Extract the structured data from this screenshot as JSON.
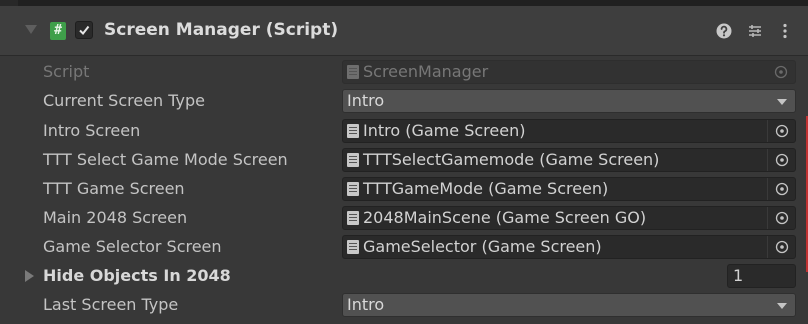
{
  "component": {
    "title": "Screen Manager (Script)",
    "enabled": true
  },
  "fields": {
    "script": {
      "label": "Script",
      "value": "ScreenManager"
    },
    "current_screen_type": {
      "label": "Current Screen Type",
      "value": "Intro"
    },
    "intro_screen": {
      "label": "Intro Screen",
      "value": "Intro (Game Screen)"
    },
    "ttt_select_game_mode_screen": {
      "label": "TTT Select Game Mode Screen",
      "value": "TTTSelectGamemode (Game Screen)"
    },
    "ttt_game_screen": {
      "label": "TTT Game Screen",
      "value": "TTTGameMode (Game Screen)"
    },
    "main_2048_screen": {
      "label": "Main 2048 Screen",
      "value": "2048MainScene (Game Screen GO)"
    },
    "game_selector_screen": {
      "label": "Game Selector Screen",
      "value": "GameSelector (Game Screen)"
    },
    "hide_objects_in_2048": {
      "label": "Hide Objects In 2048",
      "value": "1"
    },
    "last_screen_type": {
      "label": "Last Screen Type",
      "value": "Intro"
    }
  },
  "icons": {
    "script_icon": "#",
    "help": "help-icon",
    "presets": "presets-icon",
    "menu": "kebab-menu-icon",
    "picker": "object-picker-icon"
  },
  "colors": {
    "background": "#383838",
    "header": "#3e3e3e",
    "script_icon": "#3f9f4a",
    "marker": "#c23232"
  }
}
